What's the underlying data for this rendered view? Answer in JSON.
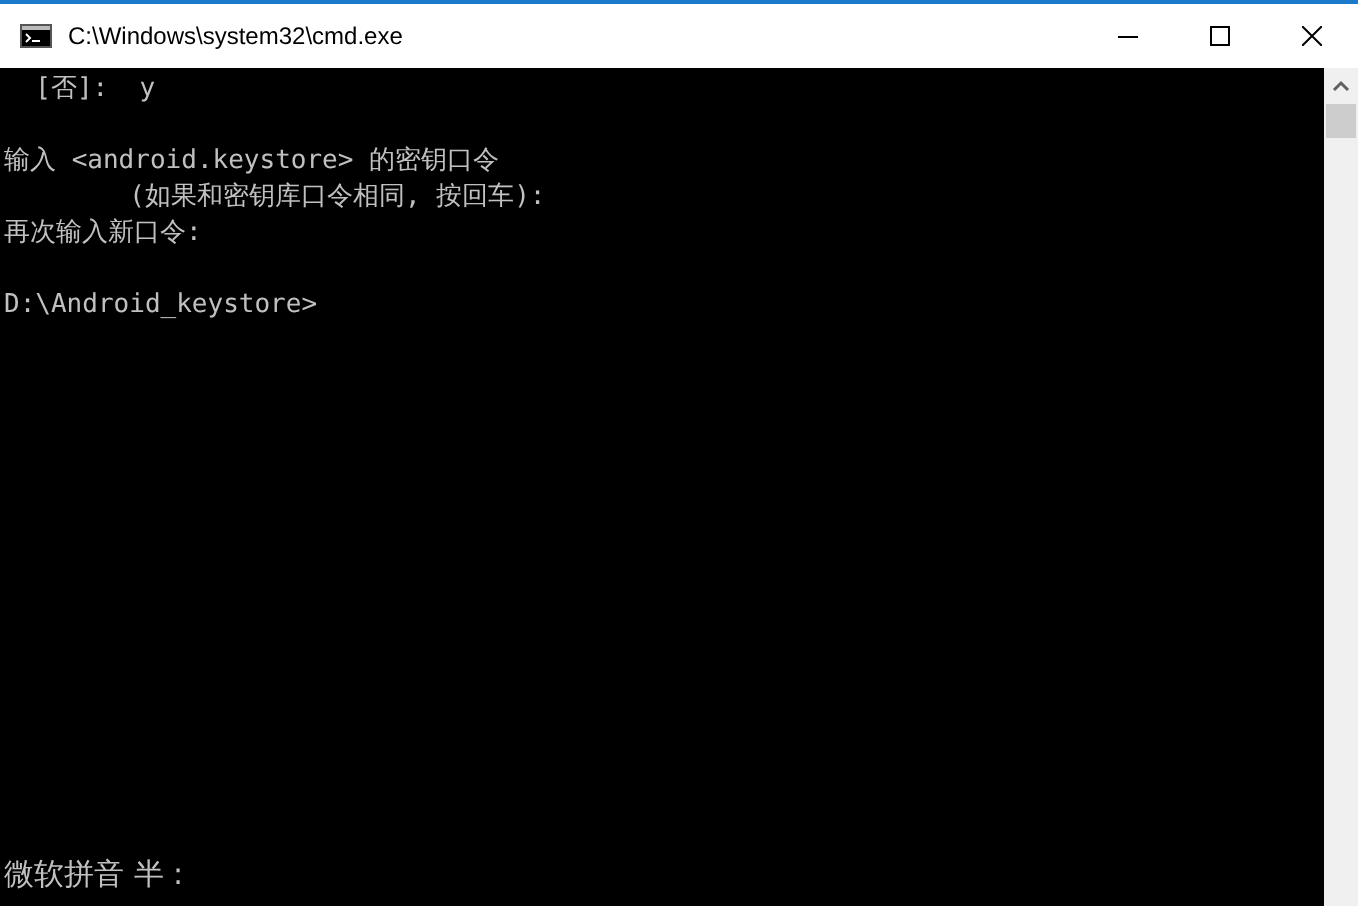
{
  "window": {
    "title": "C:\\Windows\\system32\\cmd.exe"
  },
  "console": {
    "blocks": [
      [
        "  [否]:  y"
      ],
      [
        "输入 <android.keystore> 的密钥口令",
        "        (如果和密钥库口令相同, 按回车):",
        "再次输入新口令:"
      ],
      [
        "D:\\Android_keystore>"
      ]
    ]
  },
  "ime_bar": {
    "text": "微软拼音 半 :"
  }
}
